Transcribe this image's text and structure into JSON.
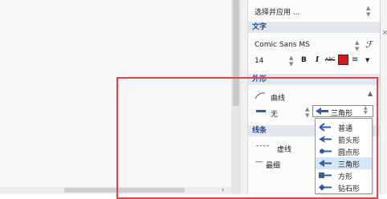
{
  "panel": {
    "app_select": "选择并应用 ...",
    "text_section": {
      "header": "文字",
      "font_family": "Comic Sans MS",
      "font_size": "14",
      "bold": "B",
      "italic": "I",
      "strike": "ABC",
      "text_color": "#c8201e"
    },
    "shape_section": {
      "header": "外形",
      "curve_label": "曲线",
      "start_label": "无",
      "end_selected": "三角形"
    },
    "line_section": {
      "header": "线条",
      "dashed_label": "虚线",
      "thickness_label": "最细"
    }
  },
  "dropdown": {
    "items": [
      {
        "label": "普通",
        "icon": "arrow-normal-icon"
      },
      {
        "label": "箭头形",
        "icon": "arrow-arrowhead-icon"
      },
      {
        "label": "圆点形",
        "icon": "arrow-dot-icon"
      },
      {
        "label": "三角形",
        "icon": "arrow-triangle-icon",
        "selected": true
      },
      {
        "label": "方形",
        "icon": "arrow-square-icon"
      },
      {
        "label": "钻石形",
        "icon": "arrow-diamond-icon"
      }
    ]
  },
  "colors": {
    "accent": "#1f4f9a",
    "highlight": "#e0454b",
    "selection": "#d7e6f7"
  }
}
